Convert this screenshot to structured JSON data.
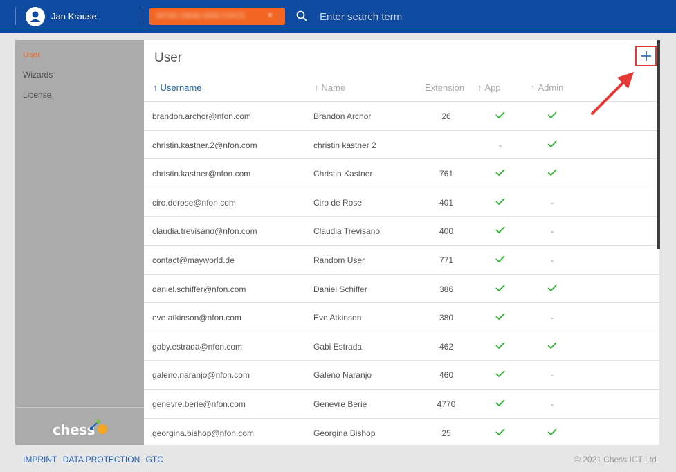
{
  "header": {
    "user_name": "Jan Krause",
    "tenant_label": "MYSK OM44 0000 COCO",
    "search_placeholder": "Enter search term",
    "brand_color": "#0e4ba0",
    "accent_color": "#f26522"
  },
  "sidebar": {
    "items": [
      {
        "label": "User",
        "active": true
      },
      {
        "label": "Wizards",
        "active": false
      },
      {
        "label": "License",
        "active": false
      }
    ],
    "logo_text": "chess"
  },
  "main": {
    "title": "User",
    "add_button_icon": "plus-icon",
    "columns": {
      "username": "Username",
      "name": "Name",
      "extension": "Extension",
      "app": "App",
      "admin": "Admin"
    },
    "rows": [
      {
        "username": "brandon.archor@nfon.com",
        "name": "Brandon Archor",
        "extension": "26",
        "app": true,
        "admin": true
      },
      {
        "username": "christin.kastner.2@nfon.com",
        "name": "christin kastner 2",
        "extension": "",
        "app": false,
        "admin": true
      },
      {
        "username": "christin.kastner@nfon.com",
        "name": "Christin Kastner",
        "extension": "761",
        "app": true,
        "admin": true
      },
      {
        "username": "ciro.derose@nfon.com",
        "name": "Ciro de Rose",
        "extension": "401",
        "app": true,
        "admin": false
      },
      {
        "username": "claudia.trevisano@nfon.com",
        "name": "Claudia Trevisano",
        "extension": "400",
        "app": true,
        "admin": false
      },
      {
        "username": "contact@mayworld.de",
        "name": "Random User",
        "extension": "771",
        "app": true,
        "admin": false
      },
      {
        "username": "daniel.schiffer@nfon.com",
        "name": "Daniel Schiffer",
        "extension": "386",
        "app": true,
        "admin": true
      },
      {
        "username": "eve.atkinson@nfon.com",
        "name": "Eve Atkinson",
        "extension": "380",
        "app": true,
        "admin": false
      },
      {
        "username": "gaby.estrada@nfon.com",
        "name": "Gabi Estrada",
        "extension": "462",
        "app": true,
        "admin": true
      },
      {
        "username": "galeno.naranjo@nfon.com",
        "name": "Galeno Naranjo",
        "extension": "460",
        "app": true,
        "admin": false
      },
      {
        "username": "genevre.berie@nfon.com",
        "name": "Genevre Berie",
        "extension": "4770",
        "app": true,
        "admin": false
      },
      {
        "username": "georgina.bishop@nfon.com",
        "name": "Georgina Bishop",
        "extension": "25",
        "app": true,
        "admin": true
      }
    ],
    "dash_symbol": "-",
    "check_color": "#2bb52b"
  },
  "footer": {
    "links": [
      "IMPRINT",
      "DATA PROTECTION",
      "GTC"
    ],
    "copyright": "© 2021 Chess ICT Ltd"
  }
}
